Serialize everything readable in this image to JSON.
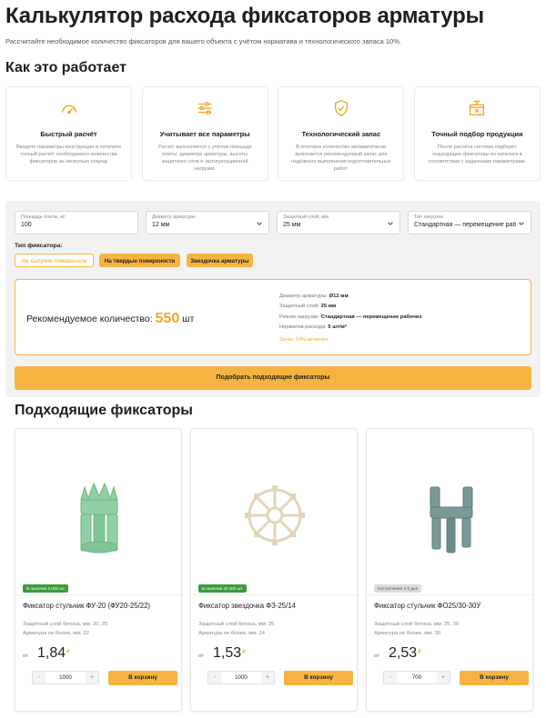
{
  "page": {
    "title": "Калькулятор расхода фиксаторов арматуры",
    "subtitle": "Рассчитайте необходимое количество фиксаторов для вашего объекта с учётом норматива и технологического запаса 10%.",
    "how_title": "Как это работает"
  },
  "features": [
    {
      "icon": "speedometer-icon",
      "title": "Быстрый расчёт",
      "desc": "Вводите параметры конструкции и получите точный расчёт необходимого количества фиксаторов за несколько секунд."
    },
    {
      "icon": "sliders-icon",
      "title": "Учитывает все параметры",
      "desc": "Расчёт выполняется с учётом площади плиты, диаметра арматуры, высоты защитного слоя и эксплуатационной нагрузки."
    },
    {
      "icon": "shield-check-icon",
      "title": "Технологический запас",
      "desc": "В итоговое количество автоматически включается рекомендуемый запас для надёжного выполнения подготовительных работ."
    },
    {
      "icon": "package-icon",
      "title": "Точный подбор продукции",
      "desc": "После расчёта система подберёт подходящие фиксаторы из каталога в соответствии с заданными параметрами."
    }
  ],
  "calc": {
    "area": {
      "label": "Площадь плиты, м²",
      "value": "100"
    },
    "diameter": {
      "label": "Диаметр арматуры",
      "value": "12 мм"
    },
    "cover": {
      "label": "Защитный слой, мм",
      "value": "25 мм"
    },
    "load": {
      "label": "Тип нагрузки",
      "value": "Стандартная — перемещение рабочих"
    },
    "type_label": "Тип фиксатора:",
    "types": [
      {
        "label": "На сыпучие поверхности",
        "active": false
      },
      {
        "label": "На твердые поверхности",
        "active": true
      },
      {
        "label": "Звездочка арматуры",
        "active": true
      }
    ],
    "result": {
      "label": "Рекомендуемое количество:",
      "value": "550",
      "unit": "шт",
      "details": [
        {
          "key": "Диаметр арматуры:",
          "value": "Ø12 мм"
        },
        {
          "key": "Защитный слой:",
          "value": "25 мм"
        },
        {
          "key": "Режим нагрузки:",
          "value": "Стандартная — перемещение рабочих"
        },
        {
          "key": "Норматив расхода:",
          "value": "5 шт/м²"
        }
      ],
      "reserve": "Запас 10% включён"
    },
    "cta": "Подобрать подходящие фиксаторы"
  },
  "products_title": "Подходящие фиксаторы",
  "products": [
    {
      "badge": "В наличии 3 000 шт",
      "badge_color": "#3d9a3d",
      "name": "Фиксатор стульчик ФУ-20 (ФУ20-25/22)",
      "spec1": "Защитный слой бетона, мм: 20, 25",
      "spec2": "Арматура не более, мм: 22",
      "from": "от",
      "price": "1,84",
      "currency": "₽",
      "qty": "1000",
      "minus": "-",
      "plus": "+",
      "buy": "В корзину",
      "color": "#8fd1a4"
    },
    {
      "badge": "В наличии 20 000 шт",
      "badge_color": "#3d9a3d",
      "name": "Фиксатор звездочка ФЗ-25/14",
      "spec1": "Защитный слой бетона, мм: 25",
      "spec2": "Арматура не более, мм: 14",
      "from": "от",
      "price": "1,53",
      "currency": "₽",
      "qty": "1000",
      "minus": "-",
      "plus": "+",
      "buy": "В корзину",
      "color": "#e6dcc0"
    },
    {
      "badge": "поступление 2-3 дня",
      "badge_color": "#dcdcdc",
      "name": "Фиксатор стульчик ФО25/30-30У",
      "spec1": "Защитный слой бетона, мм: 25, 30",
      "spec2": "Арматура не более, мм: 30",
      "from": "от",
      "price": "2,53",
      "currency": "₽",
      "qty": "700",
      "minus": "-",
      "plus": "+",
      "buy": "В корзину",
      "color": "#7a9a98"
    }
  ]
}
